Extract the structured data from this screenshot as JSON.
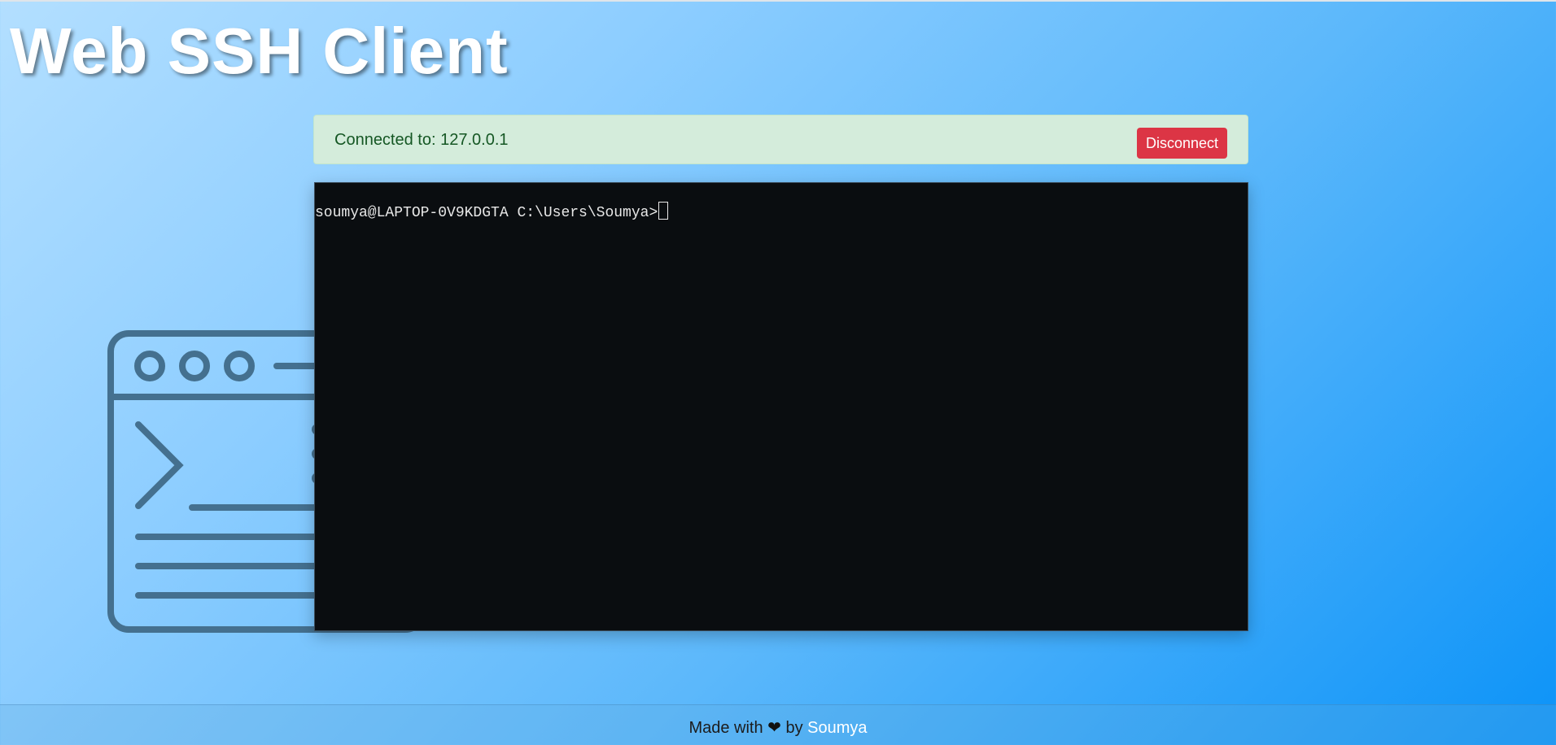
{
  "header": {
    "title": "Web SSH Client"
  },
  "connection": {
    "status_text": "Connected to: 127.0.0.1",
    "disconnect_label": "Disconnect"
  },
  "terminal": {
    "prompt": "soumya@LAPTOP-0V9KDGTA C:\\Users\\Soumya>"
  },
  "footer": {
    "made_with": "Made with",
    "heart": "❤",
    "by": "by",
    "author": "Soumya"
  },
  "colors": {
    "success_bg": "#d4ecdb",
    "success_text": "#155724",
    "danger": "#dc3545",
    "terminal_bg": "#0a0d10",
    "illustration": "#44708f"
  },
  "icons": {
    "illustration": "terminal-window-icon",
    "heart": "heart-icon"
  }
}
